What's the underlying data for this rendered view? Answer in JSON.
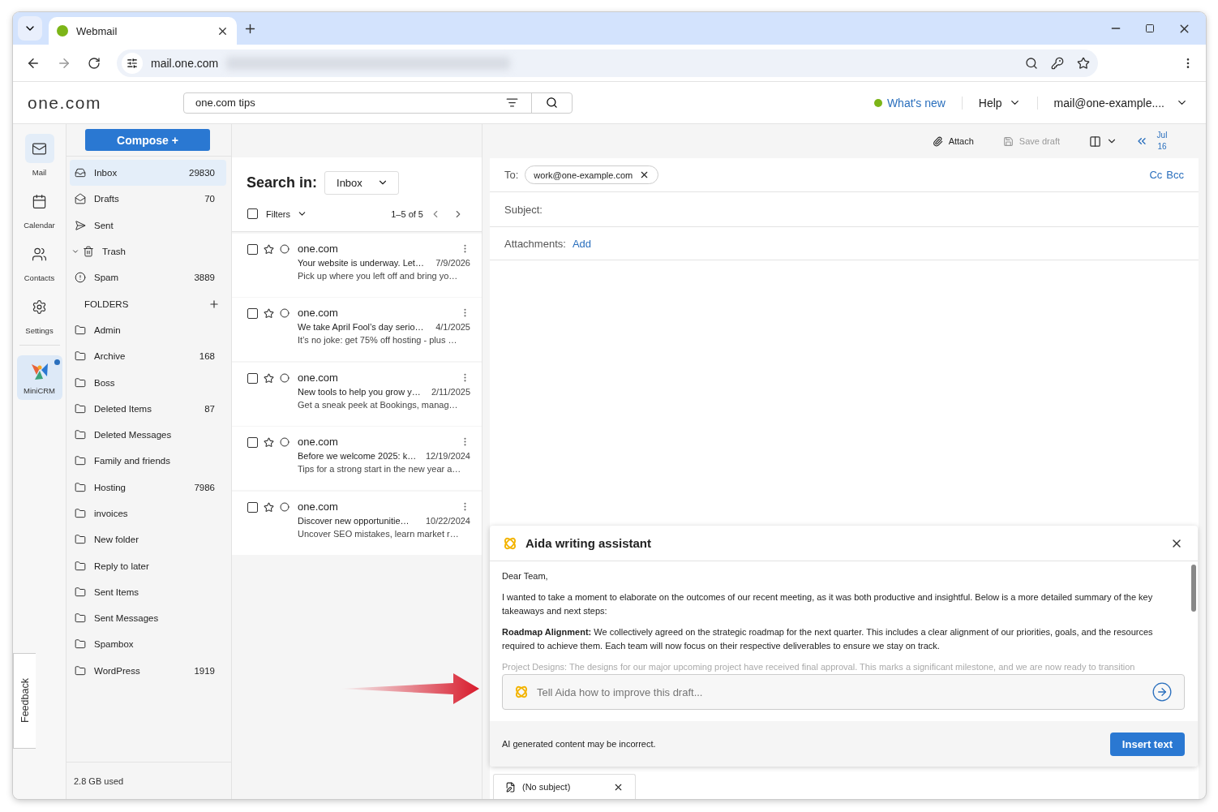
{
  "browser": {
    "tab": {
      "title": "Webmail"
    },
    "url": "mail.one.com"
  },
  "header": {
    "logo": "one.com",
    "search": {
      "value": "one.com tips"
    },
    "whats_new": "What's new",
    "help": "Help",
    "account": "mail@one-example...."
  },
  "rail": [
    {
      "label": "Mail",
      "selected": true
    },
    {
      "label": "Calendar",
      "selected": false
    },
    {
      "label": "Contacts",
      "selected": false
    },
    {
      "label": "Settings",
      "selected": false
    },
    {
      "label": "MiniCRM",
      "selected": false,
      "kind": "app",
      "notification": true
    }
  ],
  "compose_button": "Compose +",
  "mailboxes": [
    {
      "name": "Inbox",
      "count": "29830",
      "selected": true
    },
    {
      "name": "Drafts",
      "count": "70",
      "selected": false
    },
    {
      "name": "Sent",
      "selected": false
    },
    {
      "name": "Trash",
      "selected": false,
      "expanded": true
    },
    {
      "name": "Spam",
      "count": "3889",
      "selected": false
    }
  ],
  "folders": {
    "title": "FOLDERS",
    "items": [
      {
        "name": "Admin",
        "selected": false
      },
      {
        "name": "Archive",
        "count": "168",
        "selected": false
      },
      {
        "name": "Boss",
        "selected": false
      },
      {
        "name": "Deleted Items",
        "count": "87",
        "selected": false
      },
      {
        "name": "Deleted Messages",
        "selected": false
      },
      {
        "name": "Family and friends",
        "selected": false
      },
      {
        "name": "Hosting",
        "count": "7986",
        "selected": false
      },
      {
        "name": "invoices",
        "selected": false
      },
      {
        "name": "New folder",
        "selected": false
      },
      {
        "name": "Reply to later",
        "selected": false
      },
      {
        "name": "Sent Items",
        "selected": false
      },
      {
        "name": "Sent Messages",
        "selected": false
      },
      {
        "name": "Spambox",
        "selected": false
      },
      {
        "name": "WordPress",
        "count": "1919",
        "selected": false
      }
    ]
  },
  "storage": "2.8 GB used",
  "feedback": "Feedback",
  "mail_list": {
    "search_label": "Search in:",
    "scope": "Inbox",
    "filters": "Filters",
    "select_all": false,
    "range": "1–5 of 5",
    "messages": [
      {
        "sender": "one.com",
        "subject": "Your website is underway. Let…",
        "date": "7/9/2026",
        "preview": "Pick up where you left off and bring yo…",
        "checked": false,
        "starred": false
      },
      {
        "sender": "one.com",
        "subject": "We take April Fool’s day serio…",
        "date": "4/1/2025",
        "preview": "It’s no joke: get 75% off hosting - plus …",
        "checked": false,
        "starred": false
      },
      {
        "sender": "one.com",
        "subject": "New tools to help you grow y…",
        "date": "2/11/2025",
        "preview": "Get a sneak peek at Bookings, manag…",
        "checked": false,
        "starred": false
      },
      {
        "sender": "one.com",
        "subject": "Before we welcome 2025: k…",
        "date": "12/19/2024",
        "preview": "Tips for a strong start in the new year a…",
        "checked": false,
        "starred": false
      },
      {
        "sender": "one.com",
        "subject": "Discover new opportunitie…",
        "date": "10/22/2024",
        "preview": "Uncover SEO mistakes, learn market r…",
        "checked": false,
        "starred": false
      }
    ]
  },
  "compose": {
    "toolbar": {
      "attach": "Attach",
      "save_draft": {
        "label": "Save draft",
        "disabled": true
      },
      "date": "Jul 16"
    },
    "to_label": "To:",
    "recipients": [
      "work@one-example.com"
    ],
    "cc": "Cc",
    "bcc": "Bcc",
    "subject_label": "Subject:",
    "attachments_label": "Attachments:",
    "add": "Add"
  },
  "aida": {
    "title": "Aida writing assistant",
    "paragraphs": [
      "Dear Team,",
      "I wanted to take a moment to elaborate on the outcomes of our recent meeting, as it was both productive and insightful. Below is a more detailed summary of the key takeaways and next steps:",
      "**Roadmap Alignment:** We collectively agreed on the strategic roadmap for the next quarter. This includes a clear alignment of our priorities, goals, and the resources required to achieve them. Each team will now focus on their respective deliverables to ensure we stay on track.",
      "Project Designs: The designs for our major upcoming project have received final approval. This marks a significant milestone, and we are now ready to transition"
    ],
    "prompt": {
      "placeholder": "Tell Aida how to improve this draft..."
    },
    "disclaimer": "AI generated content may be incorrect.",
    "insert": "Insert text"
  },
  "drafts": [
    {
      "title": "(No subject)"
    }
  ]
}
